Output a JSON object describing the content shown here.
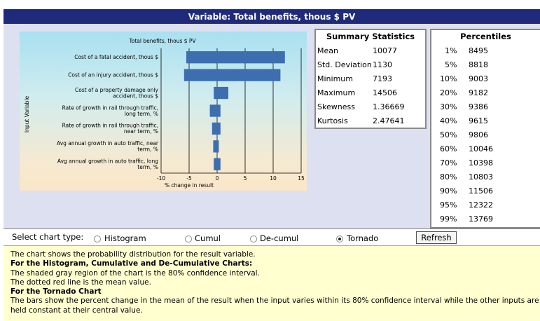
{
  "window": {
    "title": "Variable: Total benefits, thous $ PV"
  },
  "chart_data": {
    "type": "bar",
    "title": "Total benefits, thous $ PV",
    "xlabel": "% change in result",
    "ylabel": "Input Variable",
    "categories": [
      [
        "Cost of a fatal accident, thous $"
      ],
      [
        "Cost of an injury accident, thous $"
      ],
      [
        "Cost of a property damage only",
        "accident, thous $"
      ],
      [
        "Rate of growth in rail through traffic,",
        "long term, %"
      ],
      [
        "Rate of growth in rail through traffic,",
        "near term, %"
      ],
      [
        "Avg annual growth in auto traffic, near",
        "term, %"
      ],
      [
        "Avg annual growth in auto traffic, long",
        "term, %"
      ]
    ],
    "low": [
      -5.5,
      -5.9,
      -0.6,
      -1.3,
      -0.9,
      -0.7,
      -0.6
    ],
    "high": [
      12.1,
      11.3,
      2.0,
      0.6,
      0.6,
      0.3,
      0.6
    ],
    "xlim": [
      -10,
      15
    ],
    "xticks": [
      -10,
      -5,
      0,
      5,
      10,
      15
    ],
    "bar_color": "#3d6fb0"
  },
  "summary": {
    "title": "Summary Statistics",
    "rows": [
      {
        "label": "Mean",
        "value": "10077"
      },
      {
        "label": "Std. Deviation",
        "value": "1130"
      },
      {
        "label": "Minimum",
        "value": "7193"
      },
      {
        "label": "Maximum",
        "value": "14506"
      },
      {
        "label": "Skewness",
        "value": "1.36669"
      },
      {
        "label": "Kurtosis",
        "value": "2.47641"
      }
    ]
  },
  "percentiles": {
    "title": "Percentiles",
    "rows": [
      {
        "p": "1%",
        "v": "8495"
      },
      {
        "p": "5%",
        "v": "8818"
      },
      {
        "p": "10%",
        "v": "9003"
      },
      {
        "p": "20%",
        "v": "9182"
      },
      {
        "p": "30%",
        "v": "9386"
      },
      {
        "p": "40%",
        "v": "9615"
      },
      {
        "p": "50%",
        "v": "9806"
      },
      {
        "p": "60%",
        "v": "10046"
      },
      {
        "p": "70%",
        "v": "10398"
      },
      {
        "p": "80%",
        "v": "10803"
      },
      {
        "p": "90%",
        "v": "11506"
      },
      {
        "p": "95%",
        "v": "12322"
      },
      {
        "p": "99%",
        "v": "13769"
      }
    ]
  },
  "chart_type": {
    "label": "Select chart type:",
    "options": [
      "Histogram",
      "Cumul",
      "De-cumul",
      "Tornado"
    ],
    "selected": "Tornado",
    "refresh_label": "Refresh"
  },
  "help": {
    "line1": "The chart shows the probability distribution for the result variable.",
    "heading1": "For the Histogram, Cumulative and De-Cumulative Charts:",
    "line2": "The shaded gray region of the chart is the 80% confidence interval.",
    "line3": "The dotted red line is the mean value.",
    "heading2": "For the Tornado Chart",
    "line4": "The bars show the percent change in the mean of the result when the input varies within its 80% confidence interval while the other inputs are",
    "line5": "held constant at their central value."
  }
}
